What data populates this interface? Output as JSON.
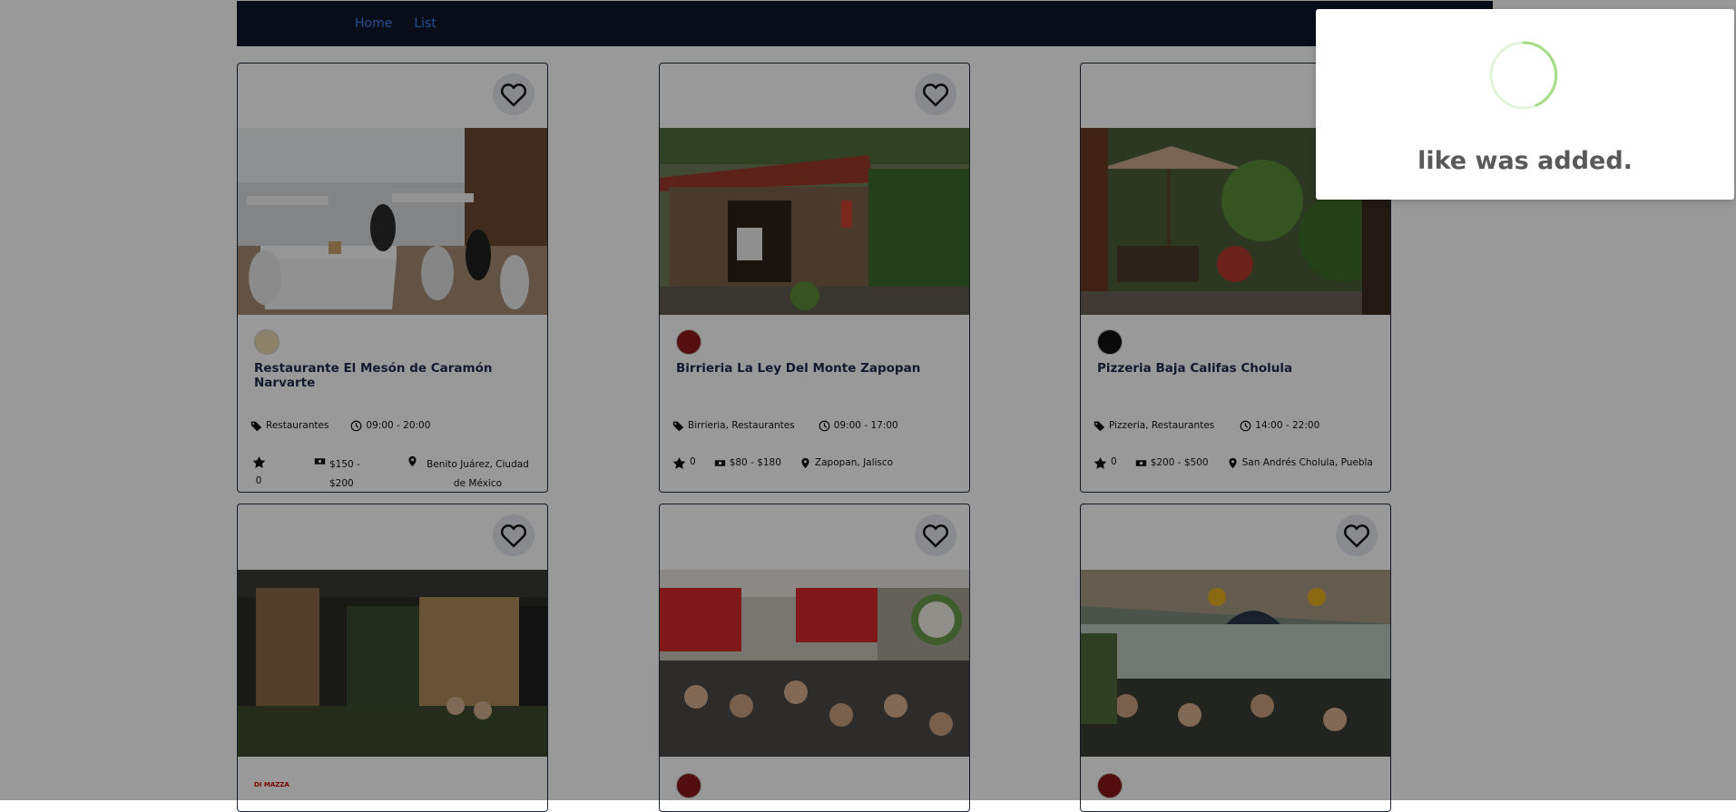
{
  "nav": {
    "links": [
      {
        "label": "Home"
      },
      {
        "label": "List"
      }
    ]
  },
  "toast": {
    "message": "like was added."
  },
  "cards": [
    {
      "title": "Restaurante El Mesón de Caramón Narvarte",
      "category": "Restaurantes",
      "hours": "09:00 - 20:00",
      "rating": "0",
      "price": "$150 - $200",
      "location": "Benito Juárez, Ciudad de México"
    },
    {
      "title": "Birrieria La Ley Del Monte Zapopan",
      "category": "Birrieria, Restaurantes",
      "hours": "09:00 - 17:00",
      "rating": "0",
      "price": "$80 - $180",
      "location": "Zapopan, Jalisco"
    },
    {
      "title": "Pizzeria Baja Califas Cholula",
      "category": "Pizzeria, Restaurantes",
      "hours": "14:00 - 22:00",
      "rating": "0",
      "price": "$200 - $500",
      "location": "San Andrés Cholula, Puebla"
    },
    {
      "title": "",
      "logo_text": "DI MAZZA"
    },
    {
      "title": ""
    },
    {
      "title": ""
    }
  ]
}
